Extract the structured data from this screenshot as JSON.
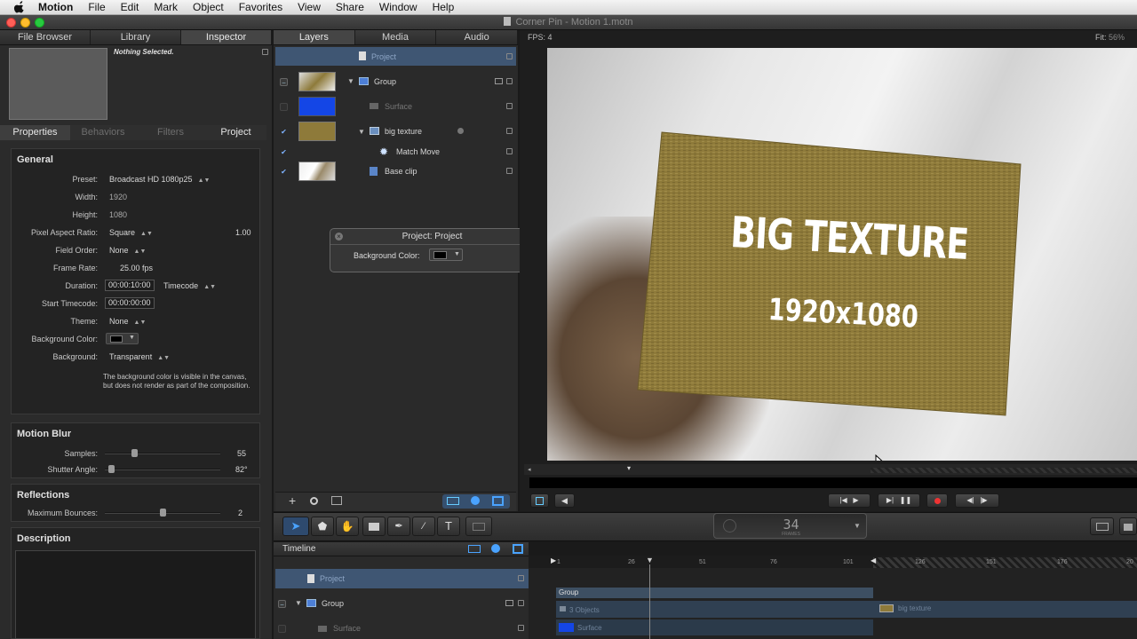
{
  "menubar": {
    "items": [
      "Motion",
      "File",
      "Edit",
      "Mark",
      "Object",
      "Favorites",
      "View",
      "Share",
      "Window",
      "Help"
    ]
  },
  "window": {
    "title": "Corner Pin - Motion 1.motn"
  },
  "left_panel": {
    "tabs": [
      "File Browser",
      "Library",
      "Inspector"
    ],
    "active_tab": "Inspector",
    "nothing_selected": "Nothing Selected.",
    "sub_tabs": [
      "Properties",
      "Behaviors",
      "Filters",
      "Project"
    ],
    "general": {
      "header": "General",
      "preset_label": "Preset:",
      "preset_value": "Broadcast HD 1080p25",
      "width_label": "Width:",
      "width_value": "1920",
      "height_label": "Height:",
      "height_value": "1080",
      "par_label": "Pixel Aspect Ratio:",
      "par_value": "Square",
      "par_number": "1.00",
      "field_order_label": "Field Order:",
      "field_order_value": "None",
      "frame_rate_label": "Frame Rate:",
      "frame_rate_value": "25.00",
      "frame_rate_unit": "fps",
      "duration_label": "Duration:",
      "duration_value": "00:00:10:00",
      "duration_format": "Timecode",
      "start_tc_label": "Start Timecode:",
      "start_tc_value": "00:00:00:00",
      "theme_label": "Theme:",
      "theme_value": "None",
      "bg_color_label": "Background Color:",
      "background_label": "Background:",
      "background_value": "Transparent",
      "note": "The background color is visible in the canvas, but does not render as part of the composition."
    },
    "motion_blur": {
      "header": "Motion Blur",
      "samples_label": "Samples:",
      "samples_value": "55",
      "samples_level": 0.25,
      "shutter_label": "Shutter Angle:",
      "shutter_value": "82°",
      "shutter_level": 0.05
    },
    "reflections": {
      "header": "Reflections",
      "bounces_label": "Maximum Bounces:",
      "bounces_value": "2",
      "bounces_level": 0.5
    },
    "description": {
      "header": "Description"
    }
  },
  "layers_panel": {
    "tabs": [
      "Layers",
      "Media",
      "Audio"
    ],
    "active_tab": "Layers",
    "rows": [
      {
        "name": "Project"
      },
      {
        "name": "Group"
      },
      {
        "name": "Surface"
      },
      {
        "name": "big texture"
      },
      {
        "name": "Match Move"
      },
      {
        "name": "Base clip"
      }
    ]
  },
  "project_hud": {
    "title": "Project: Project",
    "bg_color_label": "Background Color:"
  },
  "canvas": {
    "fps": "FPS: 4",
    "fit": "Fit:",
    "fit_value": "56%",
    "card_title": "BIG TEXTURE",
    "card_subtitle": "1920x1080"
  },
  "toolbar": {
    "frame_number": "34",
    "frame_label": "FRAMES"
  },
  "timeline": {
    "title": "Timeline",
    "rows": [
      "Project",
      "Group",
      "Surface"
    ],
    "ticks": [
      "1",
      "26",
      "51",
      "76",
      "101",
      "126",
      "151",
      "176",
      "20"
    ],
    "track_group": "Group",
    "track_objects": "3 Objects",
    "track_surface": "Surface",
    "track_texture": "big texture"
  },
  "colors": {
    "accent": "#3d78d8",
    "selection": "#3f5673",
    "card": "#8e7a3a",
    "surface_blue": "#1446e6"
  }
}
